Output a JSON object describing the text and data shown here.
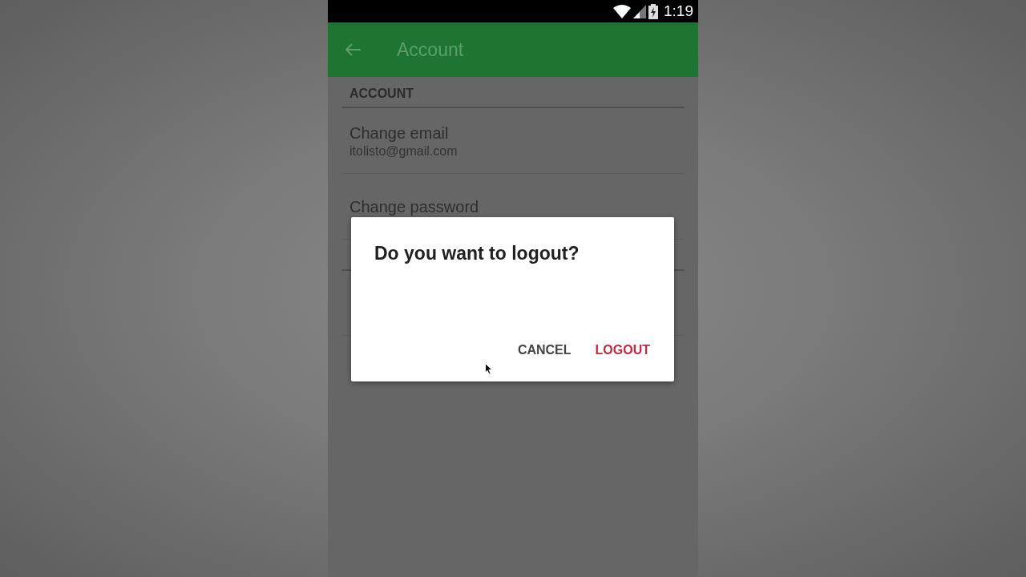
{
  "status_bar": {
    "time": "1:19"
  },
  "app_bar": {
    "title": "Account"
  },
  "sections": [
    {
      "header": "ACCOUNT",
      "items": [
        {
          "title": "Change email",
          "subtitle": "itolisto@gmail.com"
        },
        {
          "title": "Change password"
        }
      ]
    }
  ],
  "dialog": {
    "title": "Do you want to logout?",
    "buttons": [
      {
        "label": "CANCEL",
        "kind": "neutral"
      },
      {
        "label": "LOGOUT",
        "kind": "primary"
      }
    ]
  }
}
